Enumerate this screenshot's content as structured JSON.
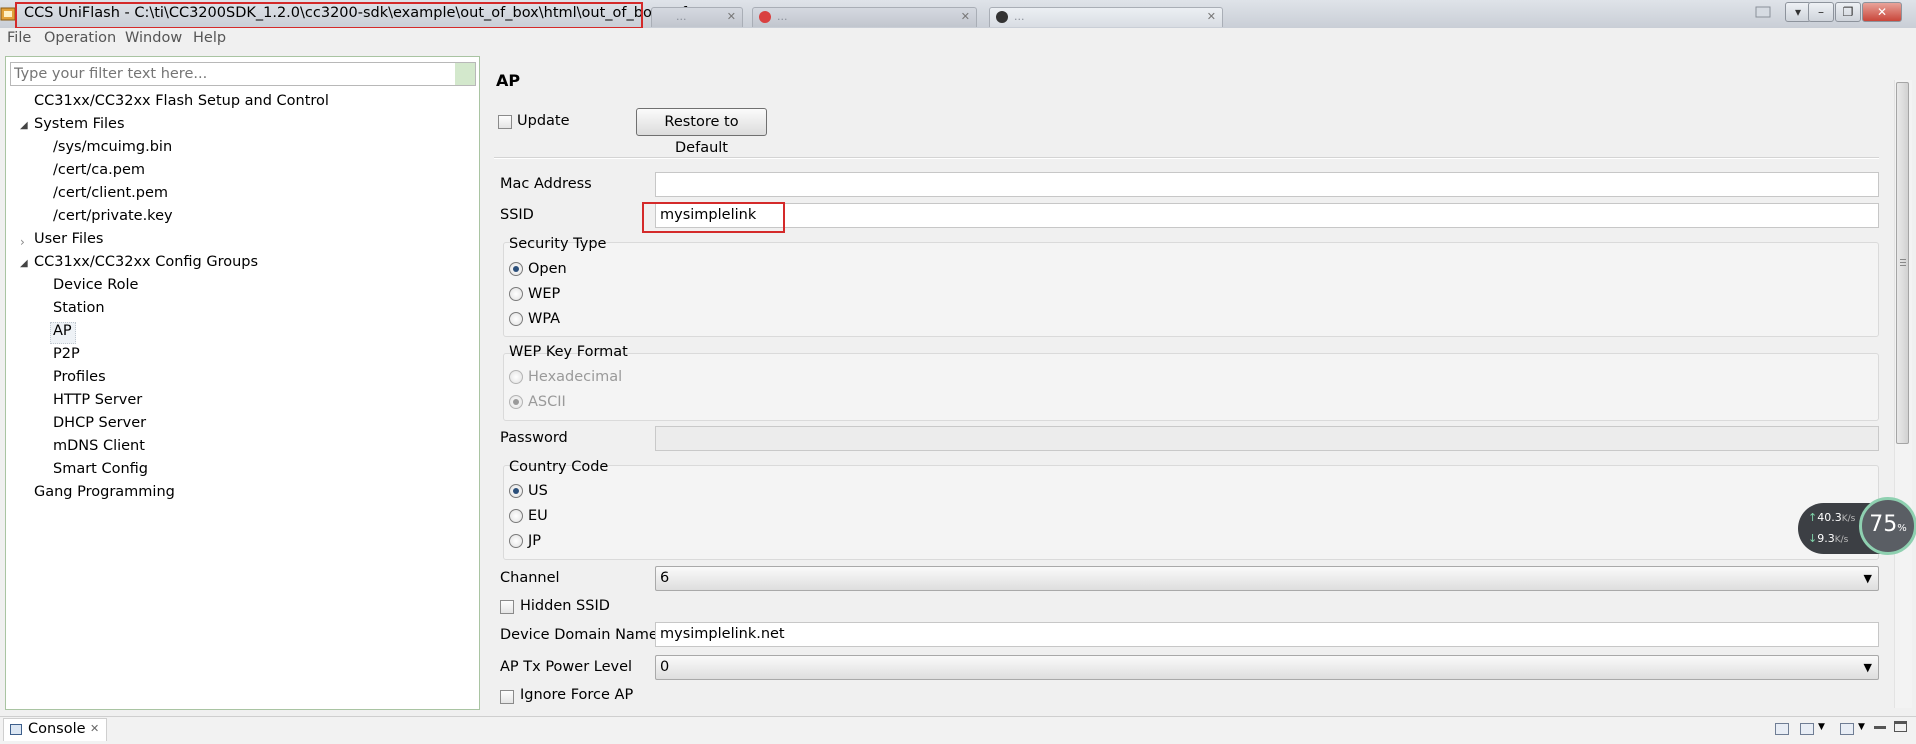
{
  "window": {
    "title": "CCS UniFlash - C:\\ti\\CC3200SDK_1.2.0\\cc3200-sdk\\example\\out_of_box\\html\\out_of_box.ucf",
    "background_tabs": [
      "...",
      "...",
      "..."
    ],
    "controls": {
      "minimize": "–",
      "maximize": "❐",
      "close": "✕",
      "extra": "▾"
    }
  },
  "menu": [
    "File",
    "Operation",
    "Window",
    "Help"
  ],
  "filter": {
    "placeholder": "Type your filter text here..."
  },
  "tree": {
    "items": [
      {
        "label": "CC31xx/CC32xx Flash Setup and Control",
        "level": 0,
        "toggle": ""
      },
      {
        "label": "System Files",
        "level": 0,
        "toggle": "expanded"
      },
      {
        "label": "/sys/mcuimg.bin",
        "level": 1,
        "toggle": ""
      },
      {
        "label": "/cert/ca.pem",
        "level": 1,
        "toggle": ""
      },
      {
        "label": "/cert/client.pem",
        "level": 1,
        "toggle": ""
      },
      {
        "label": "/cert/private.key",
        "level": 1,
        "toggle": ""
      },
      {
        "label": "User Files",
        "level": 0,
        "toggle": "collapsed"
      },
      {
        "label": "CC31xx/CC32xx Config Groups",
        "level": 0,
        "toggle": "expanded"
      },
      {
        "label": "Device Role",
        "level": 1,
        "toggle": ""
      },
      {
        "label": "Station",
        "level": 1,
        "toggle": ""
      },
      {
        "label": "AP",
        "level": 1,
        "toggle": "",
        "selected": true
      },
      {
        "label": "P2P",
        "level": 1,
        "toggle": ""
      },
      {
        "label": "Profiles",
        "level": 1,
        "toggle": ""
      },
      {
        "label": "HTTP Server",
        "level": 1,
        "toggle": ""
      },
      {
        "label": "DHCP Server",
        "level": 1,
        "toggle": ""
      },
      {
        "label": "mDNS Client",
        "level": 1,
        "toggle": ""
      },
      {
        "label": "Smart Config",
        "level": 1,
        "toggle": ""
      },
      {
        "label": "Gang Programming",
        "level": 0,
        "toggle": ""
      }
    ]
  },
  "form": {
    "title": "AP",
    "update_label": "Update",
    "update_checked": false,
    "restore_button": "Restore to Default",
    "mac_address": {
      "label": "Mac Address",
      "value": ""
    },
    "ssid": {
      "label": "SSID",
      "value": "mysimplelink"
    },
    "security_type": {
      "label": "Security Type",
      "options": [
        "Open",
        "WEP",
        "WPA"
      ],
      "selected": "Open"
    },
    "wep_key_format": {
      "label": "WEP Key Format",
      "options": [
        "Hexadecimal",
        "ASCII"
      ],
      "selected": "ASCII",
      "disabled": true
    },
    "password": {
      "label": "Password",
      "value": "",
      "disabled": true
    },
    "country_code": {
      "label": "Country Code",
      "options": [
        "US",
        "EU",
        "JP"
      ],
      "selected": "US"
    },
    "channel": {
      "label": "Channel",
      "value": "6"
    },
    "hidden_ssid": {
      "label": "Hidden SSID",
      "checked": false
    },
    "device_domain": {
      "label": "Device Domain Name",
      "value": "mysimplelink.net"
    },
    "tx_power": {
      "label": "AP Tx Power Level",
      "value": "0"
    },
    "ignore_force_ap": {
      "label": "Ignore Force AP",
      "checked": false
    }
  },
  "net_widget": {
    "upload": "40.3",
    "download": "9.3",
    "unit": "K/s",
    "percent": "75",
    "percent_sign": "%"
  },
  "console": {
    "tab_label": "Console",
    "close": "✕"
  },
  "colors": {
    "highlight_box": "#d42a2a",
    "tree_border": "#a9c4a2",
    "radio_selected": "#2b4f7a"
  }
}
